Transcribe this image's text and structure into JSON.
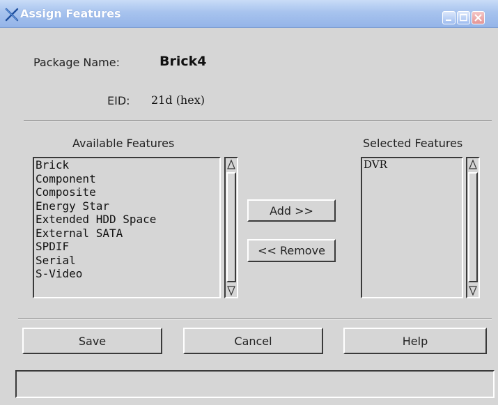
{
  "window": {
    "title": "Assign Features",
    "title_icon": "x-logo-icon",
    "controls": [
      "minimize-icon",
      "maximize-icon",
      "close-icon"
    ]
  },
  "header": {
    "package_label": "Package Name:",
    "package_value": "Brick4",
    "eid_label": "EID:",
    "eid_value": "21d (hex)"
  },
  "available": {
    "title": "Available Features",
    "items": [
      "Brick",
      "Component",
      "Composite",
      "Energy Star",
      "Extended HDD Space",
      "External SATA",
      "SPDIF",
      "Serial",
      "S-Video"
    ]
  },
  "selected": {
    "title": "Selected Features",
    "items": [
      "DVR"
    ]
  },
  "transfer": {
    "add_label": "Add >>",
    "remove_label": "<< Remove"
  },
  "footer": {
    "save_label": "Save",
    "cancel_label": "Cancel",
    "help_label": "Help"
  },
  "status": {
    "text": ""
  },
  "colors": {
    "background": "#d6d6d6",
    "titlebar": "#a7c3ee",
    "close_button": "#e49595"
  }
}
